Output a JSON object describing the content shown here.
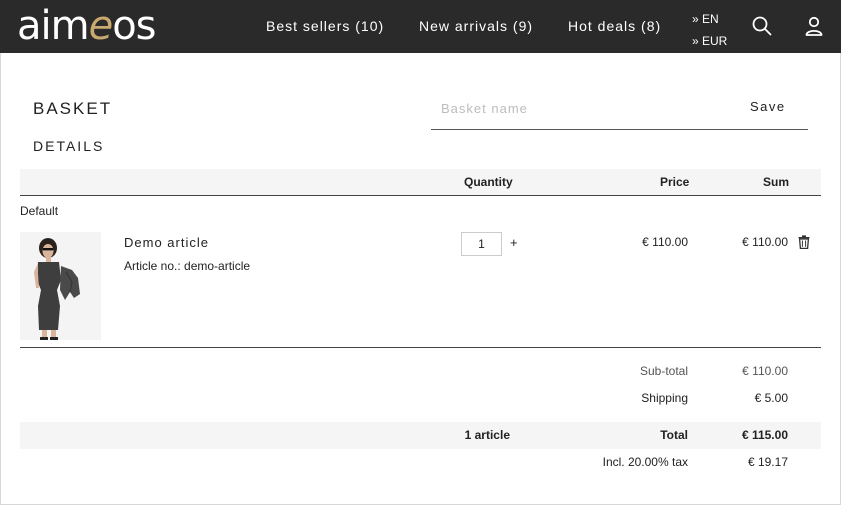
{
  "header": {
    "logo_main": "aim",
    "logo_accent": "e",
    "logo_tail": "os",
    "nav": [
      {
        "label": "Best sellers (10)"
      },
      {
        "label": "New arrivals (9)"
      },
      {
        "label": "Hot deals (8)"
      }
    ],
    "language": "» EN",
    "currency": "» EUR",
    "icons": [
      "search-icon",
      "user-icon"
    ]
  },
  "basket": {
    "title": "BASKET",
    "details_title": "DETAILS",
    "name_placeholder": "Basket name",
    "save_label": "Save"
  },
  "table": {
    "headers": {
      "quantity": "Quantity",
      "price": "Price",
      "sum": "Sum"
    },
    "group_label": "Default",
    "items": [
      {
        "name": "Demo article",
        "code_text": "Article no.: demo-article",
        "quantity": "1",
        "plus": "+",
        "price": "€ 110.00",
        "sum": "€ 110.00",
        "delete_icon": "trash-icon"
      }
    ]
  },
  "summary": {
    "subtotal_label": "Sub-total",
    "subtotal_value": "€ 110.00",
    "shipping_label": "Shipping",
    "shipping_value": "€ 5.00",
    "article_count": "1 article",
    "total_label": "Total",
    "total_value": "€ 115.00",
    "tax_label": "Incl. 20.00% tax",
    "tax_value": "€ 19.17"
  },
  "colors": {
    "header_bg": "#2a2a2a",
    "logo_accent": "#c9a96e",
    "row_bg": "#f5f5f5",
    "dress": "#3e3e3e"
  }
}
